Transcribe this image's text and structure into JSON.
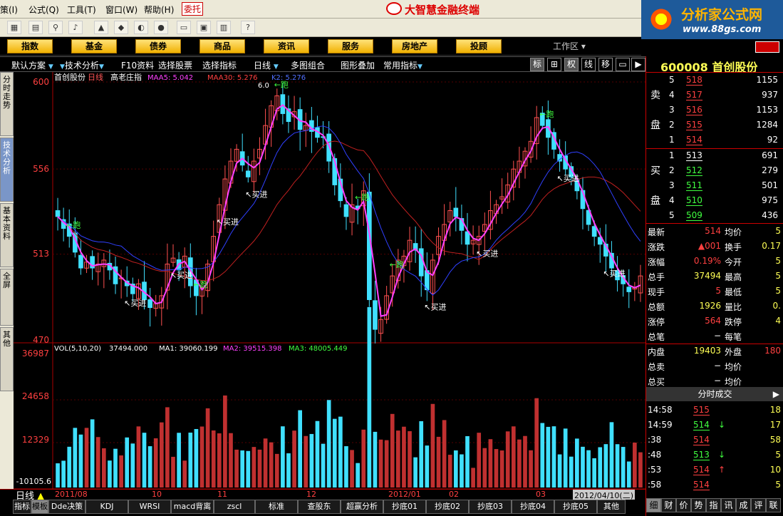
{
  "menu": {
    "items": [
      "策(I)",
      "公式(Q)",
      "工具(T)",
      "窗口(W)",
      "帮助(H)"
    ],
    "trade": "委托"
  },
  "app": {
    "title": "大智慧金融终端"
  },
  "banner": {
    "line1": "分析家公式网",
    "line2": "www.88gs.com"
  },
  "nav": {
    "buttons": [
      "指数",
      "基金",
      "债券",
      "商品",
      "资讯",
      "服务",
      "房地产",
      "投顾"
    ],
    "workarea": "工作区"
  },
  "chart_toolbar": {
    "items": [
      "默认方案",
      "技术分析",
      "F10资料",
      "选择股票",
      "选择指标",
      "日线",
      "多图组合",
      "图形叠加",
      "常用指标"
    ],
    "right": [
      "标",
      "",
      "权",
      "线",
      "移",
      "",
      ""
    ]
  },
  "left_tabs": [
    "分时走势",
    "技术分析",
    "基本资料",
    "全屏",
    "其他"
  ],
  "chart": {
    "header": {
      "name": "首创股份",
      "period": "日线",
      "indicator": "高老庄指",
      "maa5": "MAA5: 5.042",
      "maa30": "MAA30: 5.276",
      "k2": "K2: 5.276"
    },
    "price_ticks": [
      "600",
      "556",
      "513",
      "470"
    ],
    "vol_header": {
      "name": "VOL(5,10,20)",
      "v": "37494.000",
      "ma1": "MA1: 39060.199",
      "ma2": "MA2: 39515.398",
      "ma3": "MA3: 48005.449"
    },
    "vol_ticks": [
      "36987",
      "24658",
      "12329",
      "-10105.6"
    ],
    "max_label": "6.0",
    "buy_label": "买进",
    "run_label": "跑",
    "dates": [
      "2011/08",
      "10",
      "11",
      "12",
      "2012/01",
      "02",
      "03"
    ],
    "cursor_date": "2012/04/10(二)",
    "period_label": "日线",
    "colors": {
      "up": "#ff5050",
      "down": "#40e0ff",
      "ma5": "#ff40ff",
      "ma30": "#c02020",
      "ma60": "#3040ff"
    }
  },
  "chart_data": {
    "type": "candlestick",
    "ylim": [
      470,
      600
    ],
    "closes": [
      532,
      526,
      522,
      514,
      506,
      509,
      506,
      508,
      510,
      505,
      498,
      501,
      497,
      493,
      498,
      490,
      486,
      488,
      492,
      508,
      511,
      505,
      512,
      497,
      492,
      496,
      508,
      522,
      538,
      551,
      560,
      566,
      558,
      552,
      560,
      566,
      578,
      588,
      593,
      584,
      580,
      585,
      576,
      578,
      575,
      572,
      572,
      560,
      548,
      540,
      532,
      538,
      536,
      545,
      490,
      475,
      480,
      492,
      502,
      510,
      512,
      520,
      515,
      502,
      495,
      510,
      522,
      528,
      535,
      532,
      525,
      518,
      520,
      522,
      528,
      535,
      538,
      542,
      548,
      556,
      560,
      565,
      570,
      582,
      578,
      572,
      566,
      560,
      556,
      552,
      545,
      536,
      528,
      522,
      518,
      512,
      506,
      500,
      498,
      494,
      496,
      502
    ]
  },
  "bottom_tabs": [
    "指标",
    "模板",
    "Dde决策",
    "KDJ",
    "WRSI",
    "macd背离",
    "zscl",
    "标准",
    "查股东",
    "超赢分析",
    "抄底01",
    "抄底02",
    "抄底03",
    "抄底04",
    "抄底05",
    "其他"
  ],
  "quote": {
    "code_name": "600008 首创股份",
    "sell_label": [
      "卖",
      "盘"
    ],
    "buy_label": [
      "买",
      "盘"
    ],
    "sells": [
      {
        "n": "5",
        "p": "518",
        "v": "1155"
      },
      {
        "n": "4",
        "p": "517",
        "v": "937"
      },
      {
        "n": "3",
        "p": "516",
        "v": "1153"
      },
      {
        "n": "2",
        "p": "515",
        "v": "1284"
      },
      {
        "n": "1",
        "p": "514",
        "v": "92"
      }
    ],
    "buys": [
      {
        "n": "1",
        "p": "513",
        "v": "691"
      },
      {
        "n": "2",
        "p": "512",
        "v": "279"
      },
      {
        "n": "3",
        "p": "511",
        "v": "501"
      },
      {
        "n": "4",
        "p": "510",
        "v": "975"
      },
      {
        "n": "5",
        "p": "509",
        "v": "436"
      }
    ],
    "stats": [
      {
        "l": "最新",
        "v": "514",
        "l2": "均价",
        "v2": "5"
      },
      {
        "l": "涨跌",
        "v": "▲001",
        "l2": "换手",
        "v2": "0.17"
      },
      {
        "l": "涨幅",
        "v": "0.19%",
        "l2": "今开",
        "v2": "5"
      },
      {
        "l": "总手",
        "v": "37494",
        "l2": "最高",
        "v2": "5"
      },
      {
        "l": "现手",
        "v": "5",
        "l2": "最低",
        "v2": "5"
      },
      {
        "l": "总额",
        "v": "1926",
        "l2": "量比",
        "v2": "0."
      },
      {
        "l": "涨停",
        "v": "564",
        "l2": "跌停",
        "v2": "4"
      },
      {
        "l": "总笔",
        "v": "−",
        "l2": "每笔",
        "v2": ""
      },
      {
        "l": "内盘",
        "v": "19403",
        "l2": "外盘",
        "v2": "180"
      },
      {
        "l": "总卖",
        "v": "−",
        "l2": "均价",
        "v2": ""
      },
      {
        "l": "总买",
        "v": "−",
        "l2": "均价",
        "v2": ""
      }
    ],
    "ticks_title": "分时成交",
    "ticks": [
      {
        "t": "14:58",
        "p": "515",
        "a": "",
        "v": "18"
      },
      {
        "t": "14:59",
        "p": "514",
        "a": "↓",
        "v": "17"
      },
      {
        "t": ":38",
        "p": "514",
        "a": "",
        "v": "58"
      },
      {
        "t": ":48",
        "p": "513",
        "a": "↓",
        "v": "5"
      },
      {
        "t": ":53",
        "p": "514",
        "a": "↑",
        "v": "10"
      },
      {
        "t": ":58",
        "p": "514",
        "a": "",
        "v": "5"
      }
    ],
    "bottom": [
      "细",
      "财",
      "价",
      "势",
      "指",
      "讯",
      "成",
      "评",
      "联"
    ]
  }
}
